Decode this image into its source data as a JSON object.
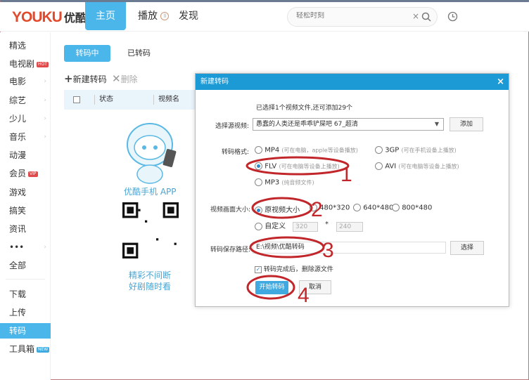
{
  "header": {
    "logo_en": "YOUKU",
    "logo_cn": "优酷",
    "nav": [
      "主页",
      "播放",
      "发现"
    ],
    "search_placeholder": "轻松时刻",
    "clear": "×"
  },
  "sidebar": {
    "items": [
      {
        "label": "精选"
      },
      {
        "label": "电视剧",
        "badge": "HOT"
      },
      {
        "label": "电影",
        "arrow": true
      },
      {
        "label": "综艺",
        "arrow": true
      },
      {
        "label": "少儿",
        "arrow": true
      },
      {
        "label": "音乐",
        "arrow": true
      },
      {
        "label": "动漫"
      },
      {
        "label": "会员",
        "badge": "VIP"
      },
      {
        "label": "游戏"
      },
      {
        "label": "搞笑"
      },
      {
        "label": "资讯"
      },
      {
        "label": "•••",
        "arrow": true
      },
      {
        "label": "全部"
      },
      {
        "label": "下载"
      },
      {
        "label": "上传"
      },
      {
        "label": "转码",
        "selected": true
      },
      {
        "label": "工具箱",
        "badge": "NEW"
      }
    ]
  },
  "main": {
    "tabs": [
      "转码中",
      "已转码"
    ],
    "new_label": "新建转码",
    "delete_label": "删除",
    "columns": [
      "状态",
      "视频名"
    ],
    "app_label": "优酷手机 APP",
    "slogan1": "精彩不间断",
    "slogan2": "好剧随时看"
  },
  "dialog": {
    "title": "新建转码",
    "info": "已选择1个视频文件,还可添加29个",
    "source_label": "选择源视频:",
    "source_value": "愚蠢的人类还是乖乖铲屎吧 67_超清",
    "add": "添加",
    "format_label": "转码格式:",
    "formats": [
      {
        "name": "MP4",
        "hint": "(可在电脑，apple等设备播放)"
      },
      {
        "name": "3GP",
        "hint": "(可在手机设备上播放)"
      },
      {
        "name": "FLV",
        "hint": "(可在电脑等设备上播放)",
        "selected": true
      },
      {
        "name": "AVI",
        "hint": "(可在电脑等设备上播放)"
      },
      {
        "name": "MP3",
        "hint": "(纯音频文件)"
      }
    ],
    "size_label": "视频画面大小:",
    "sizes": [
      "原视频大小",
      "480*320",
      "640*480",
      "800*480"
    ],
    "custom": "自定义",
    "custom_w": "320",
    "custom_h": "240",
    "times": "*",
    "path_label": "转码保存路径:",
    "path_value": "E:\\视频\\优酷转码",
    "choose": "选择",
    "delete_source": "转码完成后，删除源文件",
    "start": "开始转码",
    "cancel": "取消"
  },
  "annotations": [
    "1",
    "2",
    "3",
    "4"
  ],
  "colors": {
    "accent": "#4bb6ea",
    "dialog_title": "#1c9ad6",
    "annotation": "#c0262a"
  }
}
